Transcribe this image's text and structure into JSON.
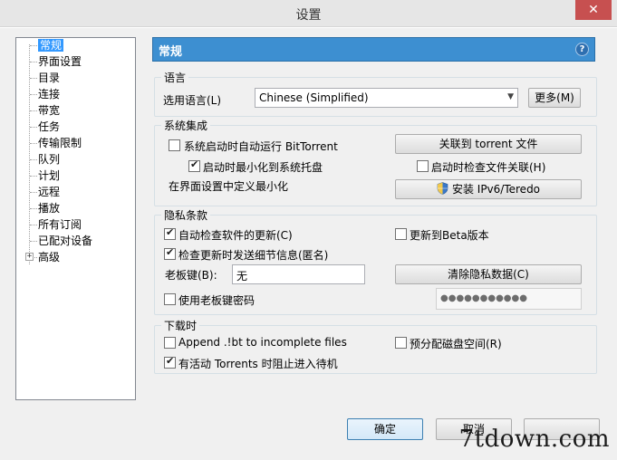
{
  "window": {
    "title": "设置",
    "close_glyph": "✕"
  },
  "tree": {
    "items": [
      {
        "label": "常规",
        "selected": true
      },
      {
        "label": "界面设置"
      },
      {
        "label": "目录"
      },
      {
        "label": "连接"
      },
      {
        "label": "带宽"
      },
      {
        "label": "任务"
      },
      {
        "label": "传输限制"
      },
      {
        "label": "队列"
      },
      {
        "label": "计划"
      },
      {
        "label": "远程"
      },
      {
        "label": "播放"
      },
      {
        "label": "所有订阅"
      },
      {
        "label": "已配对设备"
      },
      {
        "label": "高级",
        "expandable": true
      }
    ],
    "expander_glyph": "+"
  },
  "panel": {
    "title": "常规",
    "help_glyph": "?"
  },
  "language": {
    "group_label": "语言",
    "select_label": "选用语言(L)",
    "selected": "Chinese (Simplified)",
    "more_button": "更多(M)"
  },
  "system": {
    "group_label": "系统集成",
    "autostart": {
      "label": "系统启动时自动运行 BitTorrent",
      "checked": false
    },
    "minimize_tray": {
      "label": "启动时最小化到系统托盘",
      "checked": true
    },
    "custom_minimize_text": "在界面设置中定义最小化",
    "associate_button": "关联到 torrent 文件",
    "check_assoc": {
      "label": "启动时检查文件关联(H)",
      "checked": false
    },
    "ipv6_button": "安装 IPv6/Teredo"
  },
  "privacy": {
    "group_label": "隐私条款",
    "auto_update": {
      "label": "自动检查软件的更新(C)",
      "checked": true
    },
    "beta_update": {
      "label": "更新到Beta版本",
      "checked": false
    },
    "send_details": {
      "label": "检查更新时发送细节信息(匿名)",
      "checked": true
    },
    "boss_key_label": "老板键(B):",
    "boss_key_value": "无",
    "clear_button": "清除隐私数据(C)",
    "boss_password": {
      "label": "使用老板键密码",
      "checked": false
    },
    "password_value": "●●●●●●●●●●●"
  },
  "download": {
    "group_label": "下载时",
    "append_bt": {
      "label": "Append .!bt to incomplete files",
      "checked": false
    },
    "prealloc": {
      "label": "预分配磁盘空间(R)",
      "checked": false
    },
    "prevent_sleep": {
      "label": "有活动 Torrents 时阻止进入待机",
      "checked": true
    }
  },
  "footer": {
    "ok_button": "确定",
    "cancel_button": "取消"
  },
  "watermark": "7tdown.com"
}
